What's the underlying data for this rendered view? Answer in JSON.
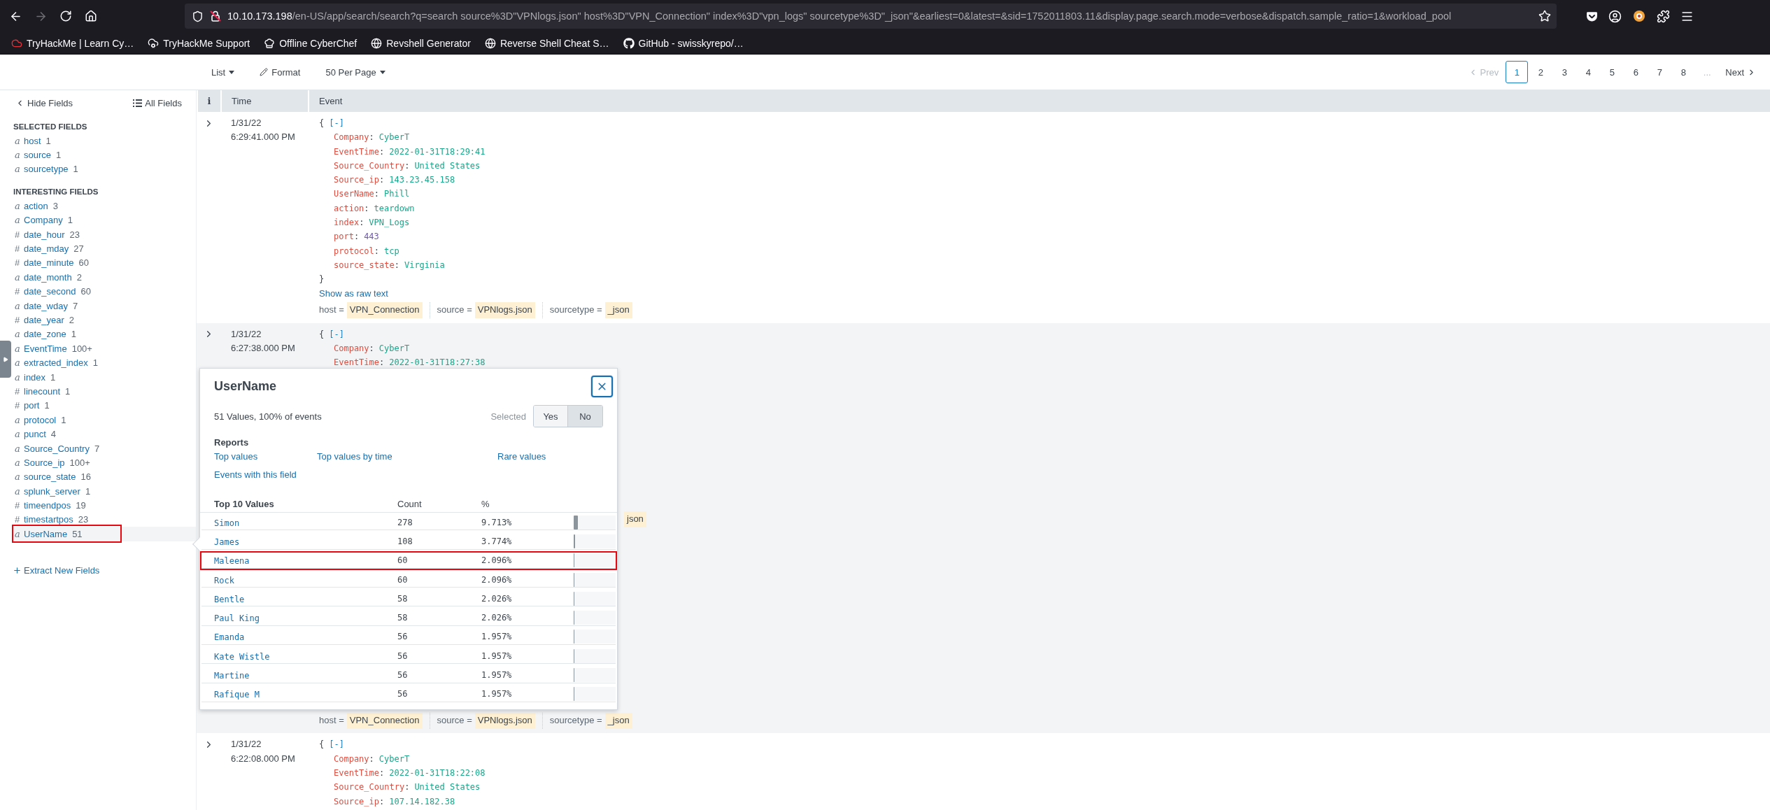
{
  "browser": {
    "url_host": "10.10.173.198",
    "url_path": "/en-US/app/search/search?q=search source%3D\"VPNlogs.json\" host%3D\"VPN_Connection\" index%3D\"vpn_logs\" sourcetype%3D\"_json\"&earliest=0&latest=&sid=1752011803.11&display.page.search.mode=verbose&dispatch.sample_ratio=1&workload_pool",
    "bookmarks": [
      "TryHackMe | Learn Cy…",
      "TryHackMe Support",
      "Offline CyberChef",
      "Revshell Generator",
      "Reverse Shell Cheat S…",
      "GitHub - swisskyrepo/…"
    ]
  },
  "toolbar": {
    "view_menu": "List",
    "format": "Format",
    "per_page": "50 Per Page",
    "pagination": {
      "prev": "Prev",
      "pages": [
        {
          "label": "1",
          "selected": true
        },
        {
          "label": "2",
          "selected": false
        },
        {
          "label": "3",
          "selected": false
        },
        {
          "label": "4",
          "selected": false
        },
        {
          "label": "5",
          "selected": false
        },
        {
          "label": "6",
          "selected": false
        },
        {
          "label": "7",
          "selected": false
        },
        {
          "label": "8",
          "selected": false
        }
      ],
      "ellipsis": "...",
      "next": "Next"
    }
  },
  "sidebar": {
    "hide_fields": "Hide Fields",
    "all_fields": "All Fields",
    "sections": [
      {
        "title": "SELECTED FIELDS",
        "fields": [
          {
            "type": "a",
            "name": "host",
            "count": "1",
            "active": false,
            "highlighted": false
          },
          {
            "type": "a",
            "name": "source",
            "count": "1",
            "active": false,
            "highlighted": false
          },
          {
            "type": "a",
            "name": "sourcetype",
            "count": "1",
            "active": false,
            "highlighted": false
          }
        ]
      },
      {
        "title": "INTERESTING FIELDS",
        "fields": [
          {
            "type": "a",
            "name": "action",
            "count": "3",
            "active": false,
            "highlighted": false
          },
          {
            "type": "a",
            "name": "Company",
            "count": "1",
            "active": false,
            "highlighted": false
          },
          {
            "type": "#",
            "name": "date_hour",
            "count": "23",
            "active": false,
            "highlighted": false
          },
          {
            "type": "#",
            "name": "date_mday",
            "count": "27",
            "active": false,
            "highlighted": false
          },
          {
            "type": "#",
            "name": "date_minute",
            "count": "60",
            "active": false,
            "highlighted": false
          },
          {
            "type": "a",
            "name": "date_month",
            "count": "2",
            "active": false,
            "highlighted": false
          },
          {
            "type": "#",
            "name": "date_second",
            "count": "60",
            "active": false,
            "highlighted": false
          },
          {
            "type": "a",
            "name": "date_wday",
            "count": "7",
            "active": false,
            "highlighted": false
          },
          {
            "type": "#",
            "name": "date_year",
            "count": "2",
            "active": false,
            "highlighted": false
          },
          {
            "type": "a",
            "name": "date_zone",
            "count": "1",
            "active": false,
            "highlighted": false
          },
          {
            "type": "a",
            "name": "EventTime",
            "count": "100+",
            "active": false,
            "highlighted": false
          },
          {
            "type": "a",
            "name": "extracted_index",
            "count": "1",
            "active": false,
            "highlighted": false
          },
          {
            "type": "a",
            "name": "index",
            "count": "1",
            "active": false,
            "highlighted": false
          },
          {
            "type": "#",
            "name": "linecount",
            "count": "1",
            "active": false,
            "highlighted": false
          },
          {
            "type": "#",
            "name": "port",
            "count": "1",
            "active": false,
            "highlighted": false
          },
          {
            "type": "a",
            "name": "protocol",
            "count": "1",
            "active": false,
            "highlighted": false
          },
          {
            "type": "a",
            "name": "punct",
            "count": "4",
            "active": false,
            "highlighted": false
          },
          {
            "type": "a",
            "name": "Source_Country",
            "count": "7",
            "active": false,
            "highlighted": false
          },
          {
            "type": "a",
            "name": "Source_ip",
            "count": "100+",
            "active": false,
            "highlighted": false
          },
          {
            "type": "a",
            "name": "source_state",
            "count": "16",
            "active": false,
            "highlighted": false
          },
          {
            "type": "a",
            "name": "splunk_server",
            "count": "1",
            "active": false,
            "highlighted": false
          },
          {
            "type": "#",
            "name": "timeendpos",
            "count": "19",
            "active": false,
            "highlighted": false
          },
          {
            "type": "#",
            "name": "timestartpos",
            "count": "23",
            "active": false,
            "highlighted": false
          },
          {
            "type": "a",
            "name": "UserName",
            "count": "51",
            "active": true,
            "highlighted": true
          }
        ]
      }
    ],
    "extract": "Extract New Fields"
  },
  "table": {
    "columns": [
      "i",
      "Time",
      "Event"
    ],
    "key_separator": ":",
    "events": [
      {
        "date": "1/31/22",
        "time": "6:29:41.000 PM",
        "open": "{",
        "collapse": "[-]",
        "fields": [
          {
            "key": "Company",
            "value": "CyberT",
            "kind": "string"
          },
          {
            "key": "EventTime",
            "value": "2022-01-31T18:29:41",
            "kind": "string"
          },
          {
            "key": "Source_Country",
            "value": "United States",
            "kind": "string"
          },
          {
            "key": "Source_ip",
            "value": "143.23.45.158",
            "kind": "string"
          },
          {
            "key": "UserName",
            "value": "Phill",
            "kind": "string"
          },
          {
            "key": "action",
            "value": "teardown",
            "kind": "string"
          },
          {
            "key": "index",
            "value": "VPN_Logs",
            "kind": "string"
          },
          {
            "key": "port",
            "value": "443",
            "kind": "number"
          },
          {
            "key": "protocol",
            "value": "tcp",
            "kind": "string"
          },
          {
            "key": "source_state",
            "value": "Virginia",
            "kind": "string"
          }
        ],
        "close": "}",
        "raw_link": "Show as raw text",
        "tags": [
          {
            "key": "host =",
            "value": "VPN_Connection"
          },
          {
            "key": "source =",
            "value": "VPNlogs.json"
          },
          {
            "key": "sourcetype =",
            "value": "_json"
          }
        ]
      },
      {
        "date": "1/31/22",
        "time": "6:27:38.000 PM",
        "open": "{",
        "collapse": "[-]",
        "fields": [
          {
            "key": "Company",
            "value": "CyberT",
            "kind": "string"
          },
          {
            "key": "EventTime",
            "value": "2022-01-31T18:27:38",
            "kind": "string"
          }
        ],
        "covered_tag": "json",
        "tags": [
          {
            "key": "host =",
            "value": "VPN_Connection"
          },
          {
            "key": "source =",
            "value": "VPNlogs.json"
          },
          {
            "key": "sourcetype =",
            "value": "_json"
          }
        ]
      },
      {
        "date": "1/31/22",
        "time": "6:22:08.000 PM",
        "open": "{",
        "collapse": "[-]",
        "fields": [
          {
            "key": "Company",
            "value": "CyberT",
            "kind": "string"
          },
          {
            "key": "EventTime",
            "value": "2022-01-31T18:22:08",
            "kind": "string"
          },
          {
            "key": "Source_Country",
            "value": "United States",
            "kind": "string"
          },
          {
            "key": "Source_ip",
            "value": "107.14.182.38",
            "kind": "string"
          }
        ]
      }
    ]
  },
  "popup": {
    "title": "UserName",
    "summary": "51 Values, 100% of events",
    "selected_label": "Selected",
    "selected_options": [
      {
        "label": "Yes",
        "selected": false
      },
      {
        "label": "No",
        "selected": true
      }
    ],
    "reports_title": "Reports",
    "reports": [
      "Top values",
      "Top values by time",
      "Rare values",
      "Events with this field"
    ],
    "columns": [
      "Top 10 Values",
      "Count",
      "%"
    ],
    "values": [
      {
        "name": "Simon",
        "count": "278",
        "percent": "9.713%",
        "level": 0.09713,
        "highlighted": false
      },
      {
        "name": "James",
        "count": "108",
        "percent": "3.774%",
        "level": 0.03774,
        "highlighted": false
      },
      {
        "name": "Maleena",
        "count": "60",
        "percent": "2.096%",
        "level": 0.02096,
        "highlighted": true
      },
      {
        "name": "Rock",
        "count": "60",
        "percent": "2.096%",
        "level": 0.02096,
        "highlighted": false
      },
      {
        "name": "Bentle",
        "count": "58",
        "percent": "2.026%",
        "level": 0.02026,
        "highlighted": false
      },
      {
        "name": "Paul King",
        "count": "58",
        "percent": "2.026%",
        "level": 0.02026,
        "highlighted": false
      },
      {
        "name": "Emanda",
        "count": "56",
        "percent": "1.957%",
        "level": 0.01957,
        "highlighted": false
      },
      {
        "name": "Kate Wistle",
        "count": "56",
        "percent": "1.957%",
        "level": 0.01957,
        "highlighted": false
      },
      {
        "name": "Martine",
        "count": "56",
        "percent": "1.957%",
        "level": 0.01957,
        "highlighted": false
      },
      {
        "name": "Rafique M",
        "count": "56",
        "percent": "1.957%",
        "level": 0.01957,
        "highlighted": false
      }
    ]
  }
}
